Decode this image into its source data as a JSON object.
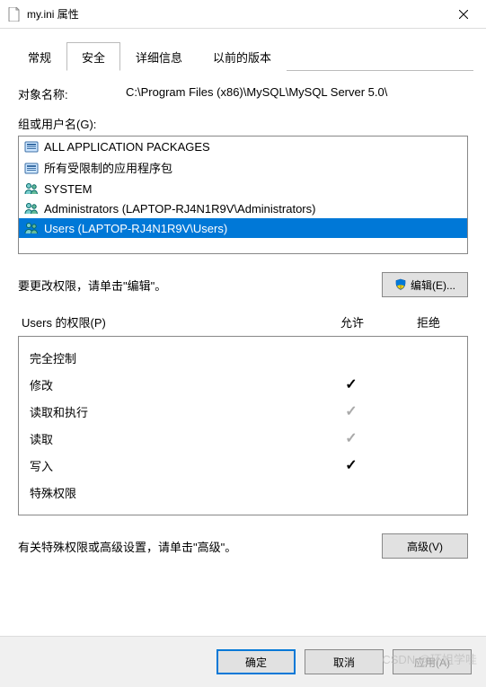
{
  "window": {
    "title": "my.ini 属性",
    "close": "×"
  },
  "tabs": [
    {
      "label": "常规"
    },
    {
      "label": "安全",
      "active": true
    },
    {
      "label": "详细信息"
    },
    {
      "label": "以前的版本"
    }
  ],
  "object": {
    "label": "对象名称:",
    "value": "C:\\Program Files (x86)\\MySQL\\MySQL Server 5.0\\"
  },
  "groups": {
    "label": "组或用户名(G):",
    "items": [
      {
        "icon": "pkg",
        "text": "ALL APPLICATION PACKAGES"
      },
      {
        "icon": "pkg",
        "text": "所有受限制的应用程序包"
      },
      {
        "icon": "user",
        "text": "SYSTEM"
      },
      {
        "icon": "user",
        "text": "Administrators (LAPTOP-RJ4N1R9V\\Administrators)"
      },
      {
        "icon": "user",
        "text": "Users (LAPTOP-RJ4N1R9V\\Users)",
        "selected": true
      }
    ]
  },
  "editRow": {
    "text": "要更改权限，请单击\"编辑\"。",
    "button": "编辑(E)..."
  },
  "permHeader": {
    "title": "Users 的权限(P)",
    "allow": "允许",
    "deny": "拒绝"
  },
  "permissions": [
    {
      "name": "完全控制",
      "allow": "",
      "deny": ""
    },
    {
      "name": "修改",
      "allow": "check",
      "deny": ""
    },
    {
      "name": "读取和执行",
      "allow": "dim",
      "deny": ""
    },
    {
      "name": "读取",
      "allow": "dim",
      "deny": ""
    },
    {
      "name": "写入",
      "allow": "check",
      "deny": ""
    },
    {
      "name": "特殊权限",
      "allow": "",
      "deny": ""
    }
  ],
  "advRow": {
    "text": "有关特殊权限或高级设置，请单击\"高级\"。",
    "button": "高级(V)"
  },
  "bottom": {
    "ok": "确定",
    "cancel": "取消",
    "apply": "应用(A)"
  },
  "watermark": "CSDN @环姐学哇"
}
